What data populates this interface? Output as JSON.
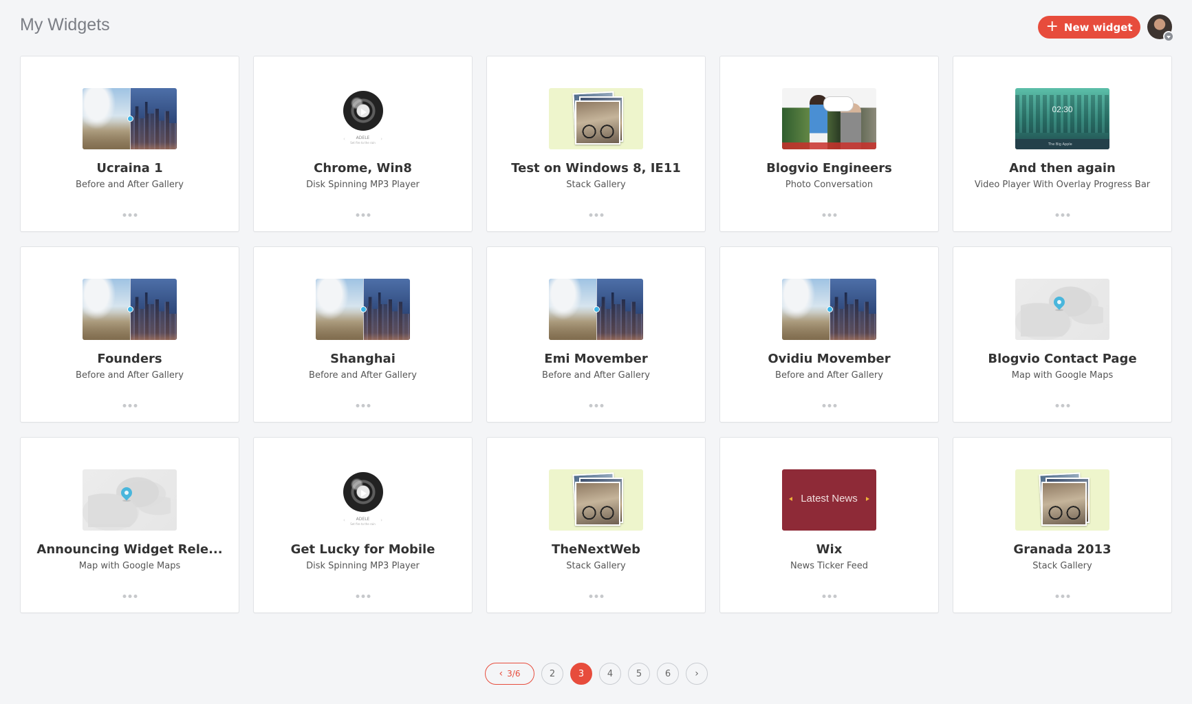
{
  "header": {
    "title": "My Widgets",
    "new_widget_label": "New widget",
    "accent_color": "#e74c3c"
  },
  "widgets": [
    {
      "title": "Ucraina 1",
      "type": "Before and After Gallery",
      "thumb": "before-after"
    },
    {
      "title": "Chrome, Win8",
      "type": "Disk Spinning MP3 Player",
      "thumb": "disk"
    },
    {
      "title": "Test on Windows 8, IE11",
      "type": "Stack Gallery",
      "thumb": "stack"
    },
    {
      "title": "Blogvio Engineers",
      "type": "Photo Conversation",
      "thumb": "photo"
    },
    {
      "title": "And then again",
      "type": "Video Player With Overlay Progress Bar",
      "thumb": "video"
    },
    {
      "title": "Founders",
      "type": "Before and After Gallery",
      "thumb": "before-after"
    },
    {
      "title": "Shanghai",
      "type": "Before and After Gallery",
      "thumb": "before-after"
    },
    {
      "title": "Emi Movember",
      "type": "Before and After Gallery",
      "thumb": "before-after"
    },
    {
      "title": "Ovidiu Movember",
      "type": "Before and After Gallery",
      "thumb": "before-after"
    },
    {
      "title": "Blogvio Contact Page",
      "type": "Map with Google Maps",
      "thumb": "map"
    },
    {
      "title": "Announcing Widget Rele...",
      "type": "Map with Google Maps",
      "thumb": "map"
    },
    {
      "title": "Get Lucky for Mobile",
      "type": "Disk Spinning MP3 Player",
      "thumb": "disk"
    },
    {
      "title": "TheNextWeb",
      "type": "Stack Gallery",
      "thumb": "stack"
    },
    {
      "title": "Wix",
      "type": "News Ticker Feed",
      "thumb": "news"
    },
    {
      "title": "Granada 2013",
      "type": "Stack Gallery",
      "thumb": "stack"
    }
  ],
  "thumb_text": {
    "disk_caption": "ADELE",
    "disk_subcaption": "Set fire to the rain",
    "video_time": "02:30",
    "video_bar_text": "The Big Apple",
    "news_text": "Latest News"
  },
  "pagination": {
    "prev_label": "3/6",
    "pages": [
      "2",
      "3",
      "4",
      "5",
      "6"
    ],
    "current": "3"
  }
}
